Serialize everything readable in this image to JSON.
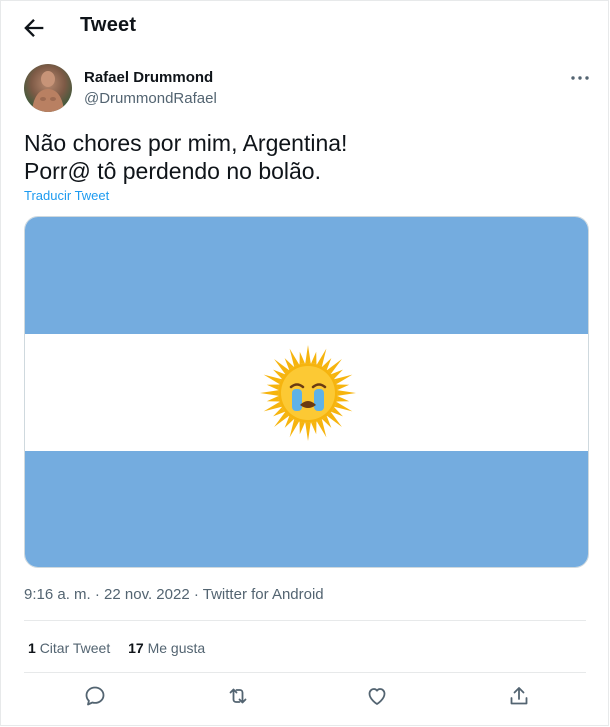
{
  "header": {
    "title": "Tweet"
  },
  "author": {
    "name": "Rafael Drummond",
    "handle": "@DrummondRafael"
  },
  "tweet": {
    "lines": [
      "Não chores por mim, Argentina!",
      "Porr@ tô perdendo no bolão."
    ],
    "translate_label": "Traducir Tweet",
    "media": {
      "emoji": "😭"
    }
  },
  "meta": {
    "time": "9:16 a. m.",
    "date": "22 nov. 2022",
    "source": "Twitter for Android",
    "sep": "·"
  },
  "stats": {
    "quotes_count": "1",
    "quotes_label": "Citar Tweet",
    "likes_count": "17",
    "likes_label": "Me gusta"
  },
  "colors": {
    "flag_blue": "#74acdf",
    "link": "#1d9bf0",
    "muted": "#536471",
    "sun": "#f6b40e"
  },
  "icons": [
    "back-arrow-icon",
    "more-icon",
    "reply-icon",
    "retweet-icon",
    "like-icon",
    "share-icon"
  ]
}
